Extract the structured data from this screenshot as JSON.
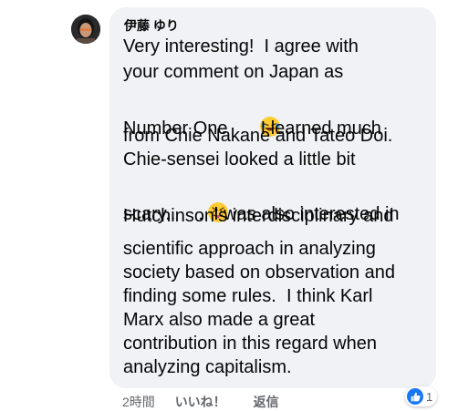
{
  "comment": {
    "author": "伊藤 ゆり",
    "lines": [
      "Very interesting!  I agree with",
      "your comment on Japan as",
      "Number One",
      "  I learned much",
      "from Chie Nakane and Tateo Doi.",
      "Chie-sensei looked a little bit",
      "scary..",
      ".  I was also interested in",
      "Hutchinson’s interdisciplinary and",
      "scientific approach in analyzing",
      "society based on observation and",
      "finding some rules.  I think Karl",
      "Marx also made a great",
      "contribution in this regard when",
      "analyzing capitalism."
    ],
    "emojis": [
      "rolling-on-floor-laughing-emoji",
      "squinting-face-with-tongue-emoji"
    ]
  },
  "actions": {
    "timestamp": "2時間",
    "like_label": "いいね！",
    "reply_label": "返信"
  },
  "reactions": {
    "icon": "like-icon",
    "count": "1",
    "color": "#1877f2"
  }
}
